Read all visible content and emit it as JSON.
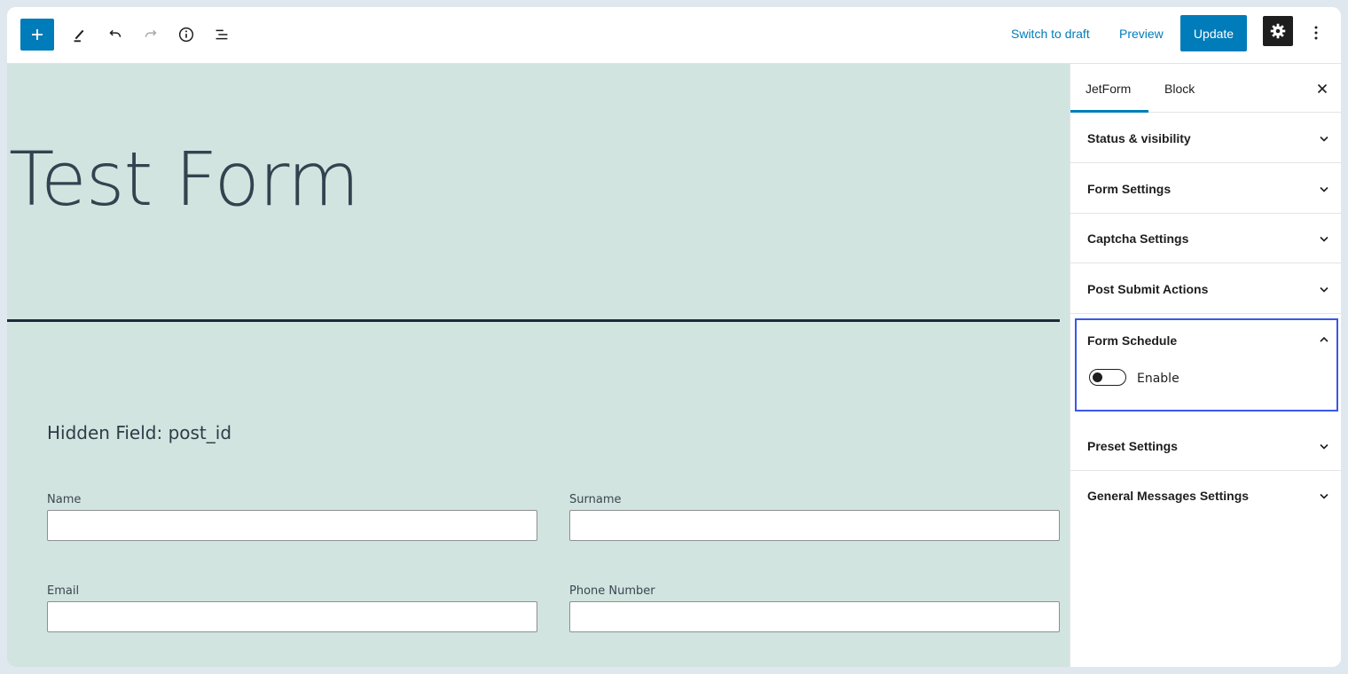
{
  "toolbar": {
    "switch_to_draft_label": "Switch to draft",
    "preview_label": "Preview",
    "update_label": "Update"
  },
  "canvas": {
    "title": "Test Form",
    "hidden_field_label": "Hidden Field: post_id",
    "fields": {
      "name_label": "Name",
      "surname_label": "Surname",
      "email_label": "Email",
      "phone_label": "Phone Number"
    }
  },
  "sidebar": {
    "tabs": [
      {
        "label": "JetForm",
        "active": true
      },
      {
        "label": "Block",
        "active": false
      }
    ],
    "panels": [
      {
        "title": "Status & visibility",
        "open": false
      },
      {
        "title": "Form Settings",
        "open": false
      },
      {
        "title": "Captcha Settings",
        "open": false
      },
      {
        "title": "Post Submit Actions",
        "open": false
      },
      {
        "title": "Form Schedule",
        "open": true,
        "toggle_label": "Enable",
        "toggle_on": false
      },
      {
        "title": "Preset Settings",
        "open": false
      },
      {
        "title": "General Messages Settings",
        "open": false
      }
    ]
  },
  "colors": {
    "accent": "#007cba",
    "canvas_bg": "#d2e4df",
    "highlight_border": "#3858e9"
  },
  "icons": [
    "plus-icon",
    "pencil-icon",
    "undo-icon",
    "redo-icon",
    "info-icon",
    "list-view-icon",
    "gear-icon",
    "more-vertical-icon",
    "close-icon",
    "chevron-down-icon",
    "chevron-up-icon"
  ]
}
